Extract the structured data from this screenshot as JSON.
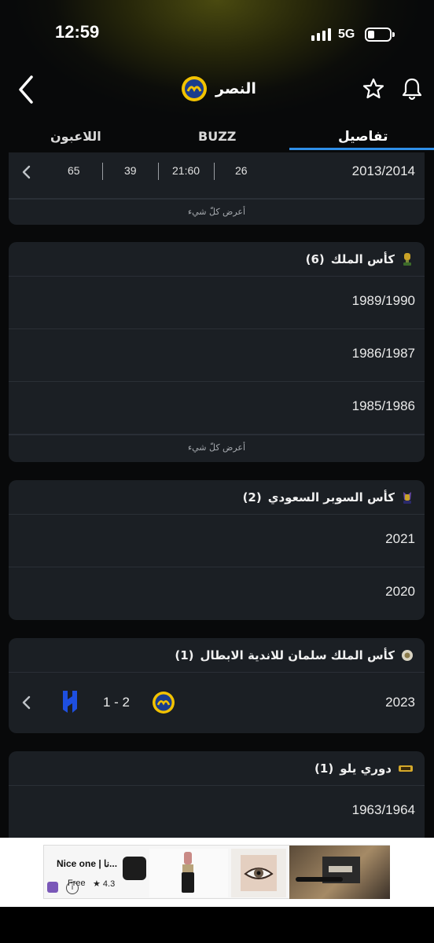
{
  "status_bar": {
    "time": "12:59",
    "network": "5G"
  },
  "header": {
    "team_name": "النصر",
    "team_logo_icon": "al-nassr-crest-icon",
    "accent_color": "#f2c200"
  },
  "tabs": {
    "details": "تفاصيل",
    "buzz": "BUZZ",
    "players": "اللاعبون",
    "active": "details",
    "active_color": "#2f8fe8"
  },
  "league_card": {
    "season": "2013/2014",
    "stats": [
      "26",
      "21:60",
      "39",
      "65"
    ],
    "show_all": "أعرض كلّ شيء"
  },
  "kings_cup": {
    "title": "كأس الملك",
    "count": "(6)",
    "seasons": [
      "1989/1990",
      "1986/1987",
      "1985/1986"
    ],
    "show_all": "أعرض كلّ شيء"
  },
  "super_cup": {
    "title": "كأس السوبر السعودي",
    "count": "(2)",
    "seasons": [
      "2021",
      "2020"
    ]
  },
  "salman_cup": {
    "title": "كأس الملك سلمان للاندية الابطال",
    "count": "(1)",
    "season": "2023",
    "score": "1 - 2",
    "opponent_icon": "al-hilal-crest-icon"
  },
  "yelo_league": {
    "title": "دوري يلو",
    "count": "(1)",
    "seasons": [
      "1963/1964"
    ]
  },
  "ad": {
    "title": "Nice one | نا...",
    "free": "Free",
    "rating": "★ 4.3"
  }
}
